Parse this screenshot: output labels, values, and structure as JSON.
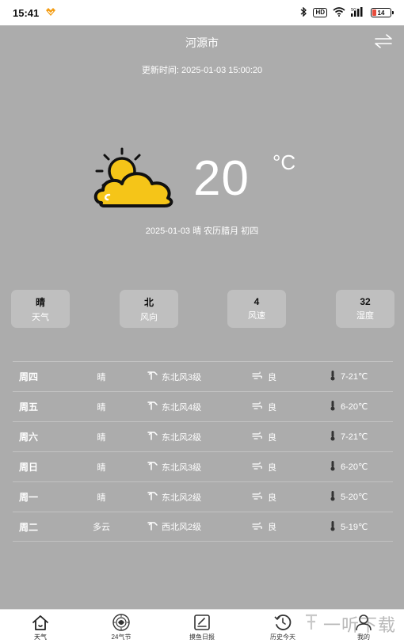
{
  "status_bar": {
    "time": "15:41",
    "hd": "HD",
    "battery": "14"
  },
  "header": {
    "city": "河源市",
    "update_time": "更新时间: 2025-01-03 15:00:20"
  },
  "current": {
    "temperature": "20",
    "unit": "°C",
    "date_line": "2025-01-03 晴 农历腊月 初四",
    "icon": "partly-cloudy-icon"
  },
  "cards": [
    {
      "value": "晴",
      "label": "天气"
    },
    {
      "value": "北",
      "label": "风向"
    },
    {
      "value": "4",
      "label": "风速"
    },
    {
      "value": "32",
      "label": "湿度"
    }
  ],
  "forecast": [
    {
      "day": "周四",
      "cond": "晴",
      "wind": "东北风3级",
      "aqi": "良",
      "temp": "7-21℃"
    },
    {
      "day": "周五",
      "cond": "晴",
      "wind": "东北风4级",
      "aqi": "良",
      "temp": "6-20℃"
    },
    {
      "day": "周六",
      "cond": "晴",
      "wind": "东北风2级",
      "aqi": "良",
      "temp": "7-21℃"
    },
    {
      "day": "周日",
      "cond": "晴",
      "wind": "东北风3级",
      "aqi": "良",
      "temp": "6-20℃"
    },
    {
      "day": "周一",
      "cond": "晴",
      "wind": "东北风2级",
      "aqi": "良",
      "temp": "5-20℃"
    },
    {
      "day": "周二",
      "cond": "多云",
      "wind": "西北风2级",
      "aqi": "良",
      "temp": "5-19℃"
    }
  ],
  "nav": [
    {
      "label": "天气",
      "icon": "home-icon"
    },
    {
      "label": "24气节",
      "icon": "solar-terms-icon"
    },
    {
      "label": "摸鱼日报",
      "icon": "daily-report-icon"
    },
    {
      "label": "历史今天",
      "icon": "history-icon"
    },
    {
      "label": "我的",
      "icon": "profile-icon"
    }
  ],
  "watermark": {
    "text": "一听下载"
  },
  "colors": {
    "background": "#acacac",
    "card": "#bfbfbf",
    "sun": "#f5c518",
    "text": "#ffffff"
  }
}
